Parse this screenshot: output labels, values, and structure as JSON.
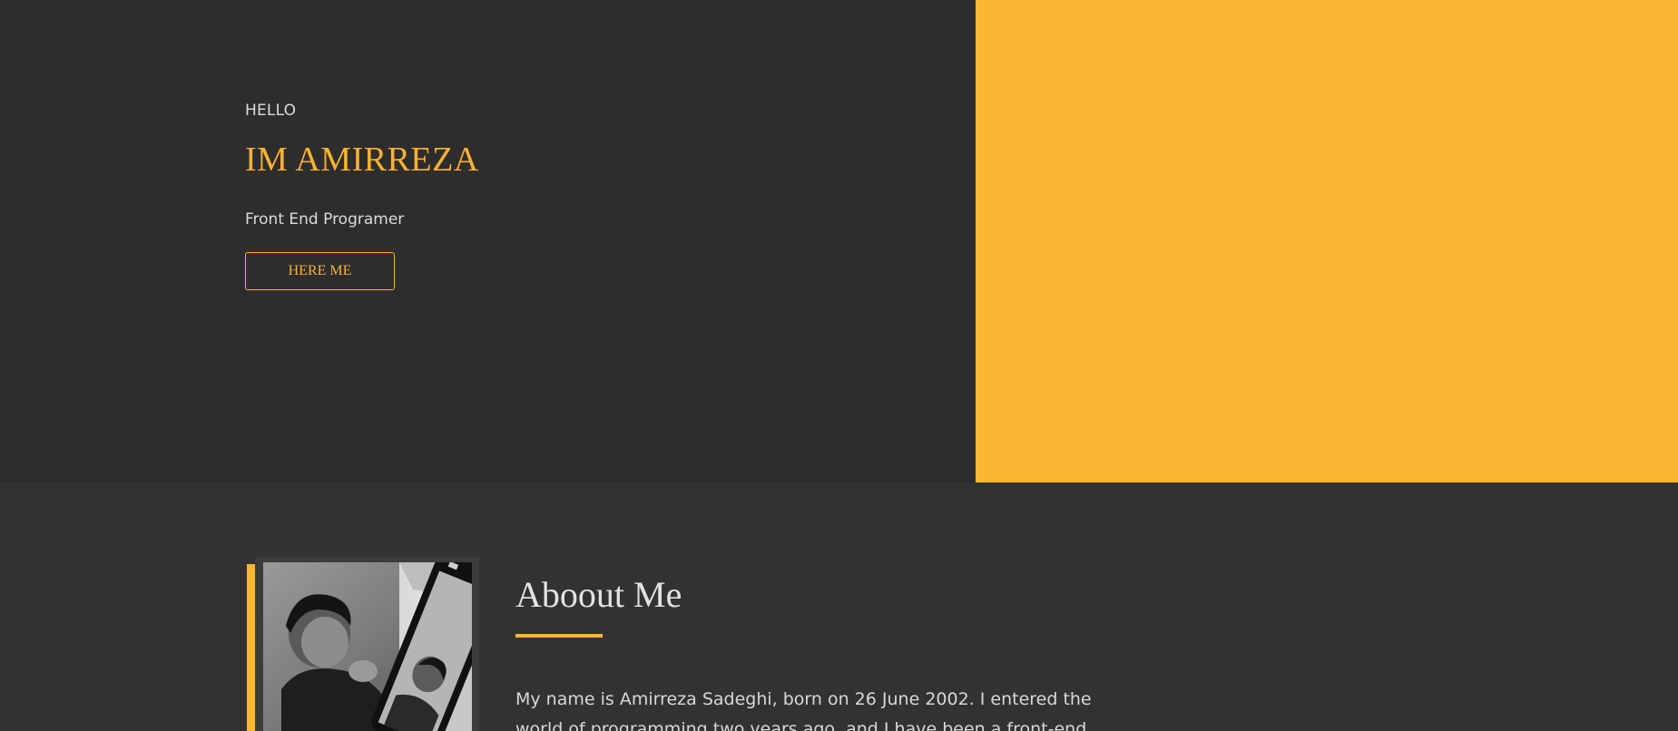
{
  "hero": {
    "greeting": "HELLO",
    "name": "IM AMIRREZA",
    "role": "Front End Programer",
    "cta_label": "HERE ME"
  },
  "about": {
    "title": "Aboout Me",
    "body": "My name is Amirreza Sadeghi, born on 26 June 2002. I entered the world of programming two years ago, and I have been a front-end"
  },
  "colors": {
    "accent": "#fdb534",
    "background": "#2d2d2d",
    "section_background": "#323232"
  }
}
